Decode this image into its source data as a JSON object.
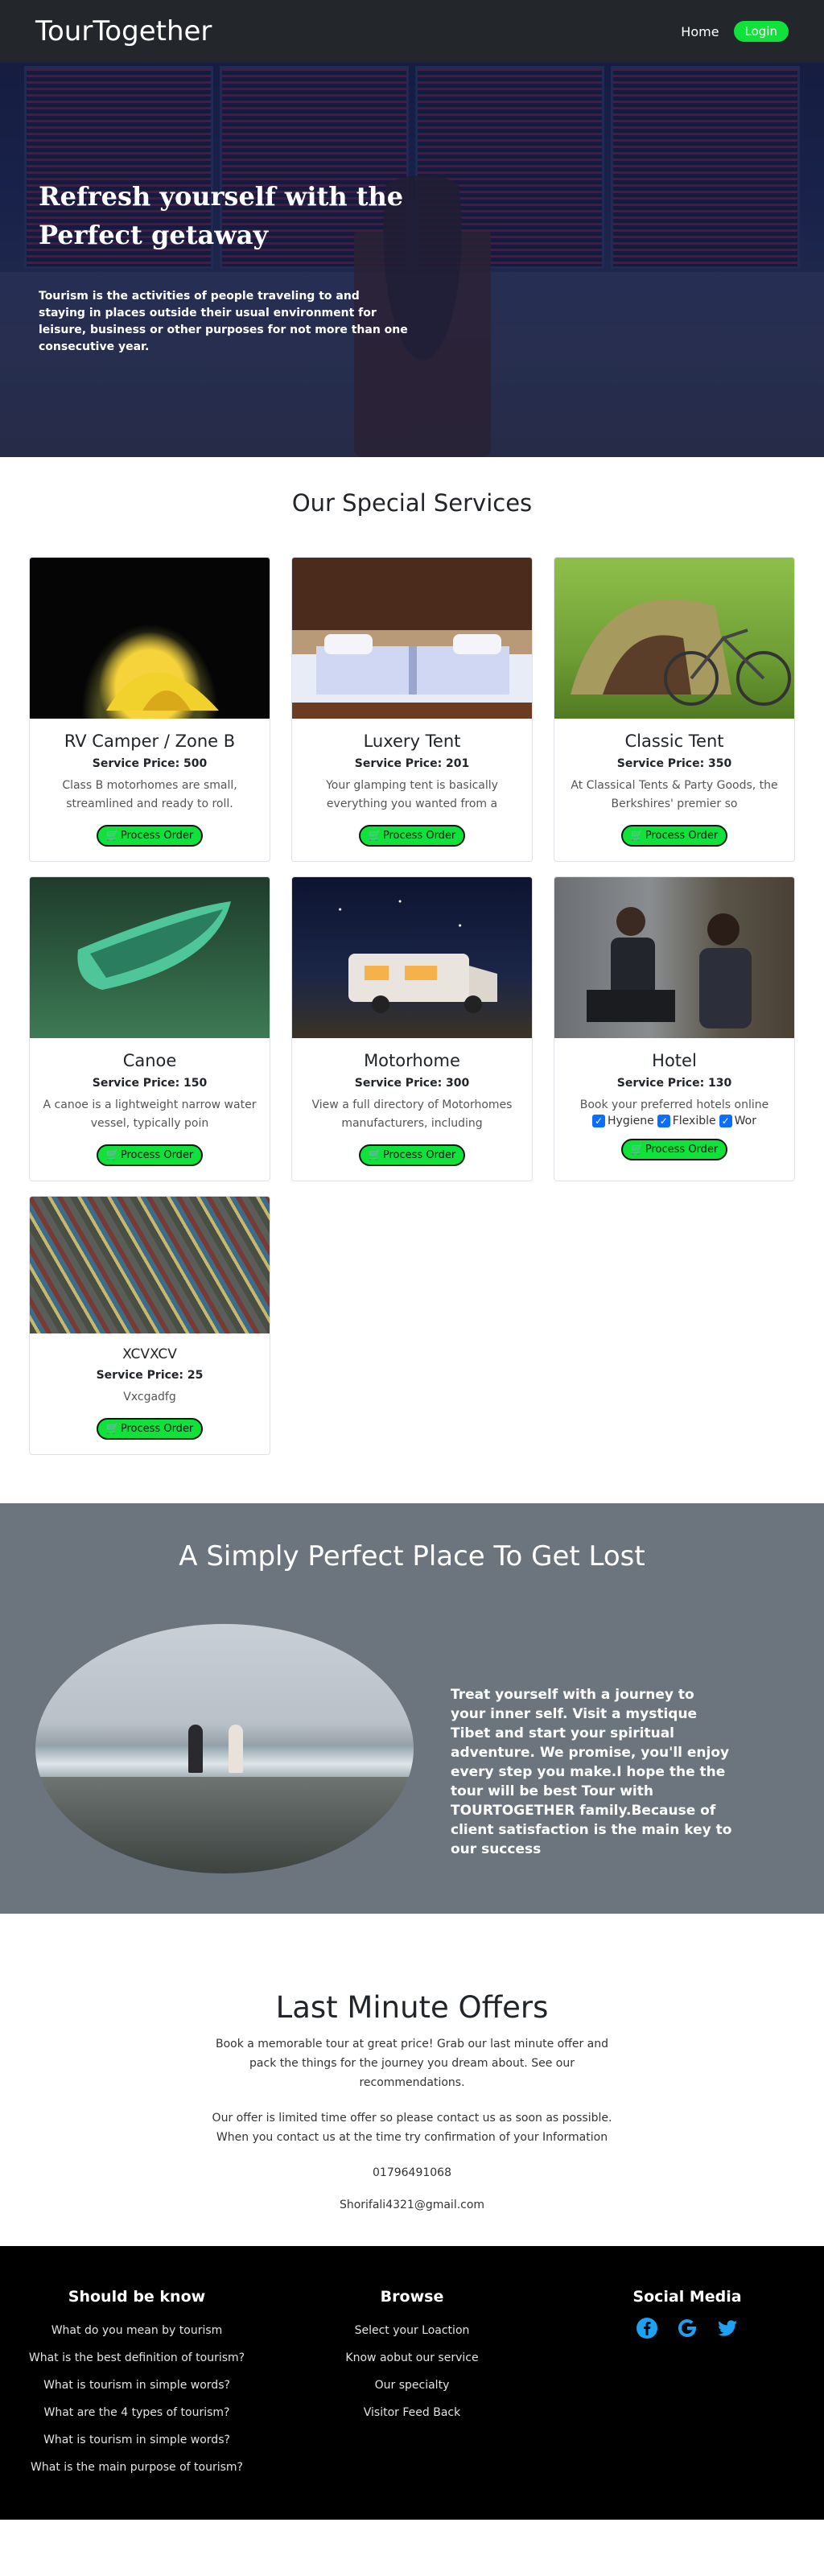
{
  "navbar": {
    "brand": "TourTogether",
    "home": "Home",
    "login": "Login"
  },
  "hero": {
    "title": "Refresh yourself with the Perfect getaway",
    "text": "Tourism is the activities of people traveling to and staying in places outside their usual environment for leisure, business or other purposes for not more than one consecutive year."
  },
  "services": {
    "title": "Our Special Services",
    "button_label": "Process Order",
    "cards": [
      {
        "title": "RV Camper / Zone B",
        "price": "Service Price: 500",
        "desc": "Class B motorhomes are small, streamlined and ready to roll."
      },
      {
        "title": "Luxery Tent",
        "price": "Service Price: 201",
        "desc": "Your glamping tent is basically everything you wanted from a"
      },
      {
        "title": "Classic Tent",
        "price": "Service Price: 350",
        "desc": "At Classical Tents & Party Goods, the Berkshires' premier so"
      },
      {
        "title": "Canoe",
        "price": "Service Price: 150",
        "desc": "A canoe is a lightweight narrow water vessel, typically poin"
      },
      {
        "title": "Motorhome",
        "price": "Service Price: 300",
        "desc": "View a full directory of Motorhomes manufacturers, including"
      },
      {
        "title": "Hotel",
        "price": "Service Price: 130",
        "desc": "Book your preferred hotels online",
        "checks": [
          "Hygiene",
          "Flexible",
          "Wor"
        ]
      },
      {
        "title": "XCVXCV",
        "price": "Service Price: 25",
        "desc": "Vxcgadfg"
      }
    ]
  },
  "perfect": {
    "title": "A Simply Perfect Place To Get Lost",
    "text": "Treat yourself with a journey to your inner self. Visit a mystique Tibet and start your spiritual adventure. We promise, you'll enjoy every step you make.I hope the the tour will be best Tour with TOURTOGETHER family.Because of client satisfaction is the main key to our success"
  },
  "offers": {
    "title": "Last Minute Offers",
    "p1": "Book a memorable tour at great price! Grab our last minute offer and pack the things for the journey you dream about. See our recommendations.",
    "p2": "Our offer is limited time offer so please contact us as soon as possible. When you contact us at the time try confirmation of your Information",
    "phone": "01796491068",
    "email": "Shorifali4321@gmail.com"
  },
  "footer": {
    "col1": {
      "title": "Should be know",
      "links": [
        "What do you mean by tourism",
        "What is the best definition of tourism?",
        "What is tourism in simple words?",
        "What are the 4 types of tourism?",
        "What is tourism in simple words?",
        "What is the main purpose of tourism?"
      ]
    },
    "col2": {
      "title": "Browse",
      "links": [
        "Select your Loaction",
        "Know aobut our service",
        "Our specialty",
        "Visitor Feed Back"
      ]
    },
    "col3": {
      "title": "Social Media",
      "icons": [
        "facebook-icon",
        "google-icon",
        "twitter-icon"
      ]
    }
  },
  "colors": {
    "accent_green": "#10e23b",
    "navbar": "#23262b",
    "section_gray": "#6c757d",
    "footer": "#000000",
    "social_blue": "#1da1f2"
  }
}
